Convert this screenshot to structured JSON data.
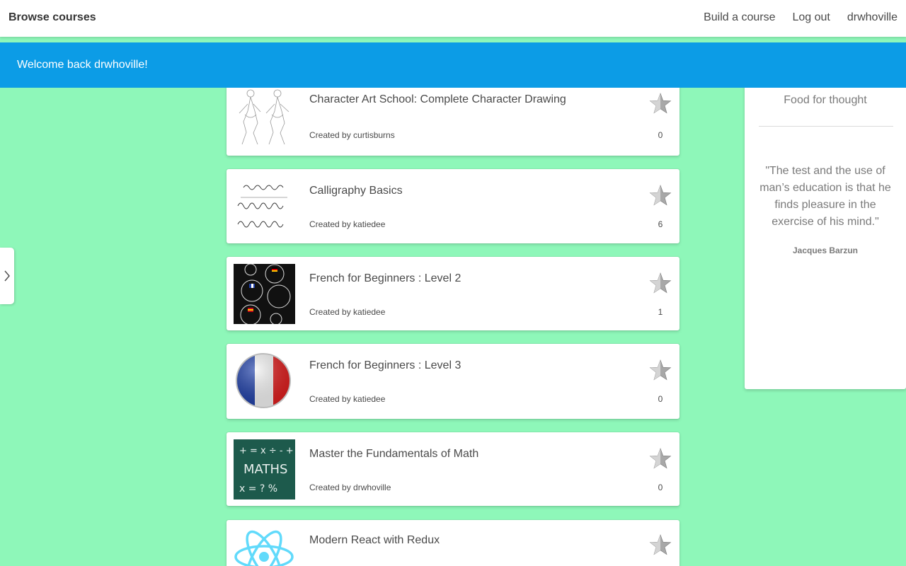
{
  "navbar": {
    "brand": "Browse courses",
    "links": [
      "Build a course",
      "Log out",
      "drwhoville"
    ]
  },
  "notification": {
    "message": "Welcome back drwhoville!"
  },
  "sidebar_toggle": {
    "icon": "chevron-right-icon"
  },
  "courses": [
    {
      "title": "Character Art School: Complete Character Drawing",
      "author": "Created by curtisburns",
      "stars": "0",
      "thumbnail": "character-sketch"
    },
    {
      "title": "Calligraphy Basics",
      "author": "Created by katiedee",
      "stars": "6",
      "thumbnail": "calligraphy-alphabet"
    },
    {
      "title": "French for Beginners : Level 2",
      "author": "Created by katiedee",
      "stars": "1",
      "thumbnail": "speech-bubbles-chalkboard"
    },
    {
      "title": "French for Beginners : Level 3",
      "author": "Created by katiedee",
      "stars": "0",
      "thumbnail": "french-flag-orb"
    },
    {
      "title": "Master the Fundamentals of Math",
      "author": "Created by drwhoville",
      "stars": "0",
      "thumbnail": "maths-chalkboard",
      "thumb_text": "MATHS"
    },
    {
      "title": "Modern React with Redux",
      "author": "",
      "stars": "",
      "thumbnail": "react-logo"
    }
  ],
  "quote_panel": {
    "heading": "Food for thought",
    "quote": "\"The test and the use of man’s education is that he finds pleasure in the exercise of his mind.\"",
    "author": "Jacques Barzun"
  },
  "colors": {
    "background": "#8ef7b9",
    "notification": "#0c9ce6",
    "react_logo": "#61dafb",
    "flag_blue": "#1e3fa8",
    "flag_red": "#e02020"
  }
}
